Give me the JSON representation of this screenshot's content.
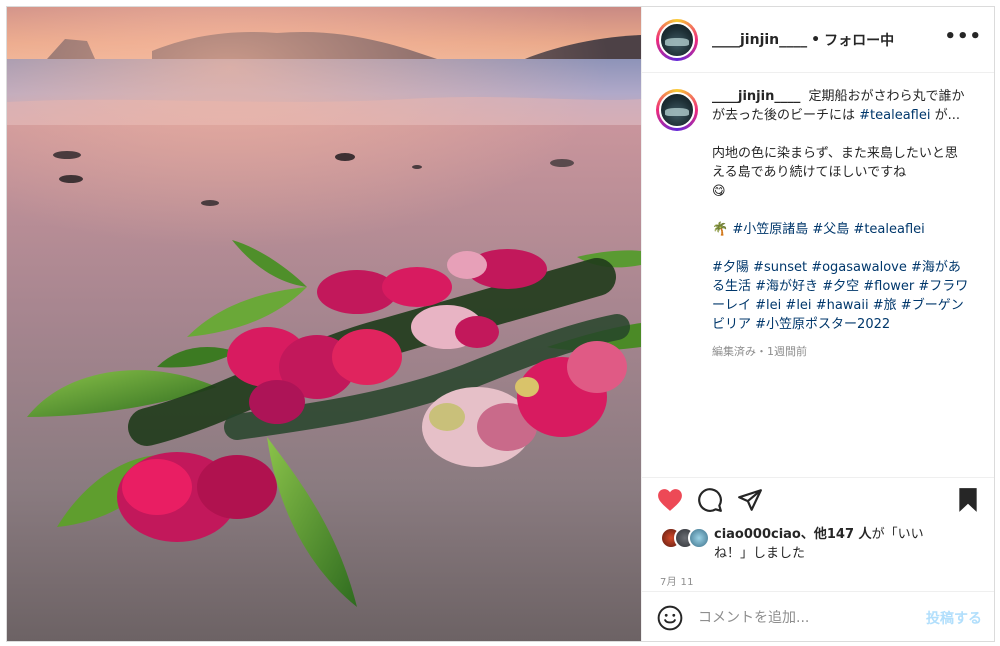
{
  "post": {
    "username": "____jinjin____",
    "follow_dot": "•",
    "follow_status": "フォロー中",
    "more_label": "•••",
    "caption": {
      "username": "____jinjin____",
      "line1": "定期船おがさわら丸で誰かが去った後のビーチには",
      "tag1": "#tealeaflei",
      "line1_end": " が...",
      "para2": "内地の色に染まらず、また来島したいと思える島であり続けてほしいですね",
      "para2_emoji": "😋",
      "palm_emoji": "🌴",
      "tags_row1": [
        "#小笠原諸島",
        "#父島",
        "#tealeaflei"
      ],
      "tags_row2": [
        "#夕陽",
        "#sunset",
        "#ogasawalove",
        "#海がある生活",
        "#海が好き",
        "#夕空",
        "#flower",
        "#フラワーレイ",
        "#lei",
        "#lei",
        "#hawaii",
        "#旅",
        "#ブーゲンビリア",
        "#小笠原ポスター2022"
      ]
    },
    "edited_meta": "編集済み・1週間前",
    "likes": {
      "user": "ciao000ciao",
      "connector": "、他",
      "count": "147 人",
      "suffix": "が「いいね！」しました"
    },
    "date": "7月 11",
    "comment": {
      "placeholder": "コメントを追加...",
      "submit_label": "投稿する"
    }
  },
  "colors": {
    "heart": "#ed4956",
    "hashtag": "#00376b",
    "post_button_disabled": "#b2dffc",
    "secondary_text": "#8e8e8e"
  },
  "icons": [
    "more-icon",
    "heart-icon",
    "comment-icon",
    "share-icon",
    "bookmark-icon",
    "emoji-icon"
  ]
}
